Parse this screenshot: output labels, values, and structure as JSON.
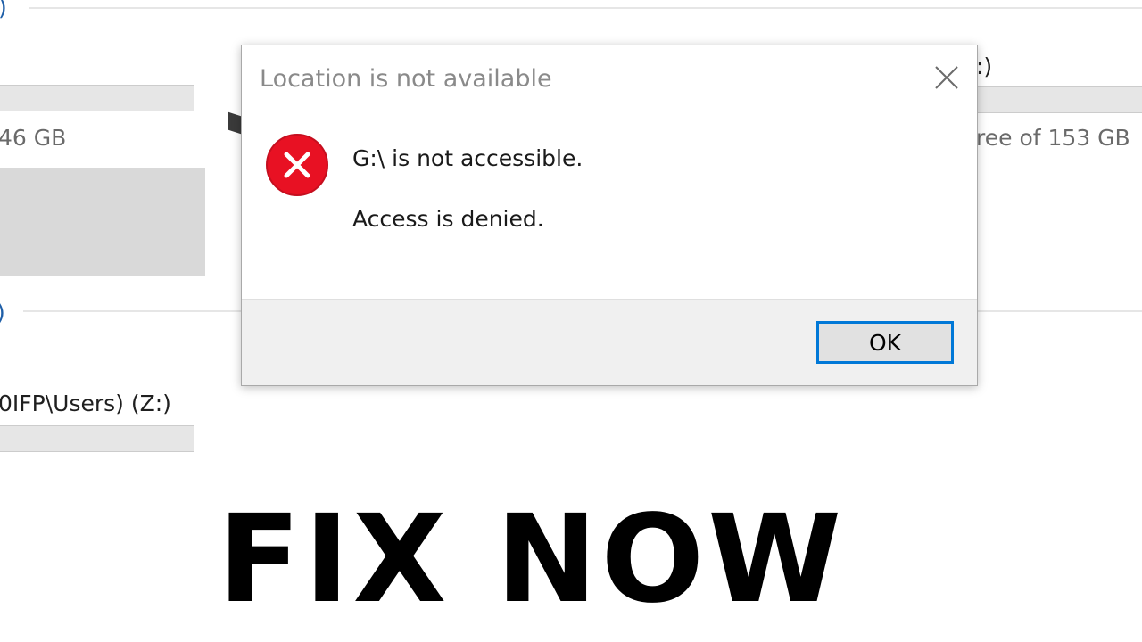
{
  "background": {
    "section1_paren": ")",
    "drive_left_size": "46 GB",
    "drive_right_label_tail": ":)",
    "drive_right_size": "ree of 153 GB",
    "section2_paren": ")",
    "network_drive_label": "0IFP\\Users) (Z:)"
  },
  "dialog": {
    "title": "Location is not available",
    "close_icon": "close-icon",
    "error_icon": "error-icon",
    "message_line1": "G:\\ is not accessible.",
    "message_line2": "Access is denied.",
    "ok_label": "OK",
    "colors": {
      "error_red": "#e81123",
      "focus_blue": "#0078d7"
    }
  },
  "overlay": {
    "headline": "FIX NOW"
  }
}
